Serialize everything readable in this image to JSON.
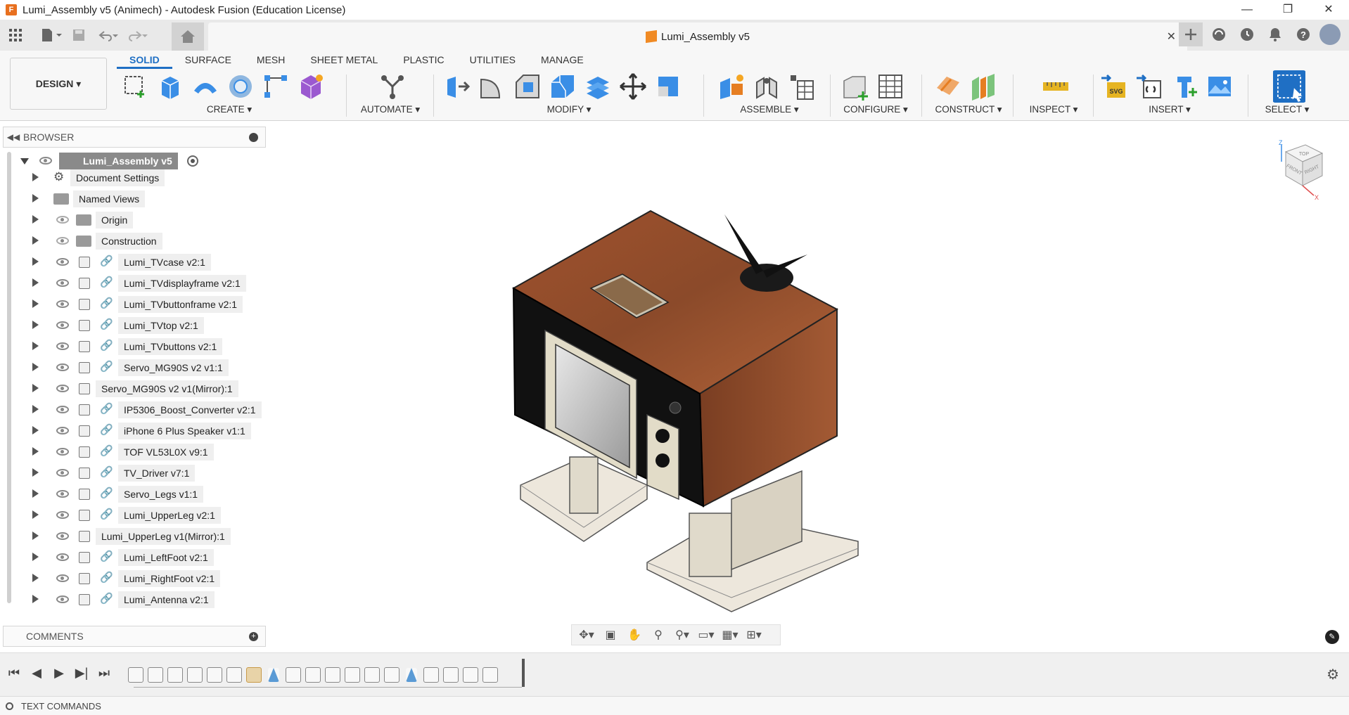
{
  "window": {
    "title": "Lumi_Assembly v5 (Animech) - Autodesk Fusion (Education License)",
    "app_icon_letter": "F",
    "controls": [
      "—",
      "❐",
      "✕"
    ]
  },
  "quick_access": {
    "icons": [
      "grid-icon",
      "file-icon",
      "save-icon",
      "undo-icon",
      "redo-icon"
    ],
    "home_icon": "home-icon",
    "document_tab": {
      "title": "Lumi_Assembly v5",
      "close": "✕"
    },
    "right_icons": [
      "plus-icon",
      "extensions-icon",
      "clock-icon",
      "bell-icon",
      "help-icon"
    ]
  },
  "ribbon": {
    "workspace": "DESIGN ▾",
    "tabs": [
      {
        "label": "SOLID",
        "active": true
      },
      {
        "label": "SURFACE",
        "active": false
      },
      {
        "label": "MESH",
        "active": false
      },
      {
        "label": "SHEET METAL",
        "active": false
      },
      {
        "label": "PLASTIC",
        "active": false
      },
      {
        "label": "UTILITIES",
        "active": false
      },
      {
        "label": "MANAGE",
        "active": false
      }
    ],
    "groups": {
      "create": "CREATE ▾",
      "automate": "AUTOMATE ▾",
      "modify": "MODIFY ▾",
      "assemble": "ASSEMBLE ▾",
      "configure": "CONFIGURE ▾",
      "construct": "CONSTRUCT ▾",
      "inspect": "INSPECT ▾",
      "insert": "INSERT ▾",
      "select": "SELECT ▾"
    },
    "accent_color": "#1f6fc4"
  },
  "browser": {
    "title": "BROWSER",
    "root": "Lumi_Assembly v5",
    "items": [
      {
        "label": "Document Settings",
        "kind": "settings"
      },
      {
        "label": "Named Views",
        "kind": "folder"
      },
      {
        "label": "Origin",
        "kind": "folder-hidden"
      },
      {
        "label": "Construction",
        "kind": "folder-hidden"
      },
      {
        "label": "Lumi_TVcase v2:1",
        "kind": "linked"
      },
      {
        "label": "Lumi_TVdisplayframe v2:1",
        "kind": "linked"
      },
      {
        "label": "Lumi_TVbuttonframe v2:1",
        "kind": "linked"
      },
      {
        "label": "Lumi_TVtop v2:1",
        "kind": "linked"
      },
      {
        "label": "Lumi_TVbuttons v2:1",
        "kind": "linked"
      },
      {
        "label": "Servo_MG90S v2 v1:1",
        "kind": "linked"
      },
      {
        "label": "Servo_MG90S v2 v1(Mirror):1",
        "kind": "local"
      },
      {
        "label": "IP5306_Boost_Converter v2:1",
        "kind": "linked"
      },
      {
        "label": "iPhone 6 Plus Speaker v1:1",
        "kind": "linked"
      },
      {
        "label": "TOF VL53L0X v9:1",
        "kind": "linked"
      },
      {
        "label": "TV_Driver v7:1",
        "kind": "linked"
      },
      {
        "label": "Servo_Legs v1:1",
        "kind": "linked"
      },
      {
        "label": "Lumi_UpperLeg v2:1",
        "kind": "linked"
      },
      {
        "label": "Lumi_UpperLeg v1(Mirror):1",
        "kind": "local"
      },
      {
        "label": "Lumi_LeftFoot v2:1",
        "kind": "linked"
      },
      {
        "label": "Lumi_RightFoot v2:1",
        "kind": "linked"
      },
      {
        "label": "Lumi_Antenna v2:1",
        "kind": "linked"
      }
    ]
  },
  "comments": {
    "title": "COMMENTS"
  },
  "viewcube": {
    "top": "TOP",
    "front": "FRONT",
    "right": "RIGHT",
    "z": "Z",
    "x": "X"
  },
  "navbar": {
    "icons": [
      "orbit-icon",
      "look-at-icon",
      "pan-icon",
      "zoom-icon",
      "zoom-window-icon",
      "display-settings-icon",
      "grid-icon",
      "viewports-icon"
    ]
  },
  "timeline": {
    "controls": [
      "⏮",
      "◀",
      "▶",
      "▶|",
      "⏭"
    ],
    "features": [
      "joint",
      "joint",
      "joint",
      "joint",
      "joint",
      "joint",
      "joint-alt",
      "plane",
      "joint",
      "joint",
      "joint",
      "joint",
      "joint",
      "joint",
      "plane",
      "joint",
      "joint",
      "joint",
      "joint"
    ]
  },
  "text_commands": {
    "title": "TEXT COMMANDS"
  }
}
